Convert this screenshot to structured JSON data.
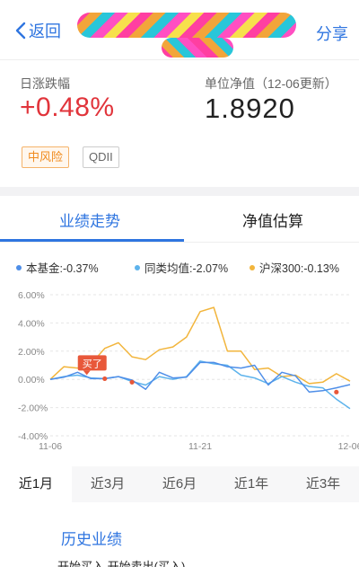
{
  "nav": {
    "back_label": "返回",
    "share_label": "分享"
  },
  "summary": {
    "change_label": "日涨跌幅",
    "change_value": "+0.48%",
    "nav_label": "单位净值（12-06更新）",
    "nav_value": "1.8920",
    "tags": [
      "中风险",
      "QDII"
    ]
  },
  "colors": {
    "accent": "#2f75e0",
    "up": "#e1343b",
    "series_fund": "#4e8ee8",
    "series_peer": "#5db3ec",
    "series_index": "#f2b53c"
  },
  "tabs": [
    "业绩走势",
    "净值估算"
  ],
  "legend": [
    {
      "label": "本基金:-0.37%",
      "color": "#4e8ee8"
    },
    {
      "label": "同类均值:-2.07%",
      "color": "#5db3ec"
    },
    {
      "label": "沪深300:-0.13%",
      "color": "#f2b53c"
    }
  ],
  "periods": [
    "近1月",
    "近3月",
    "近6月",
    "近1年",
    "近3年"
  ],
  "history": {
    "title": "历史业绩",
    "table_header": "开始买入 开始卖出(买入)"
  },
  "chart_data": {
    "type": "line",
    "y_tick_labels": [
      "6.00%",
      "4.00%",
      "2.00%",
      "0.00%",
      "-2.00%",
      "-4.00%"
    ],
    "x_tick_labels": [
      "11-06",
      "11-21",
      "12-06"
    ],
    "ylim": [
      -4,
      6
    ],
    "y_unit": "%",
    "grid": true,
    "x_count": 23,
    "series": [
      {
        "name": "本基金",
        "color": "#4e8ee8",
        "values": [
          0,
          0.15,
          0.5,
          0.05,
          0.05,
          0.2,
          -0.05,
          -0.7,
          0.5,
          0.1,
          0.15,
          1.2,
          1.2,
          0.9,
          0.8,
          1.0,
          -0.4,
          0.5,
          0.25,
          -0.9,
          -0.8,
          -0.6,
          -0.37
        ]
      },
      {
        "name": "同类均值",
        "color": "#5db3ec",
        "values": [
          0,
          0.2,
          0.3,
          0.1,
          0.05,
          0.2,
          -0.15,
          -0.4,
          0.2,
          0,
          0.2,
          1.3,
          1.1,
          1.0,
          0.3,
          0.1,
          -0.3,
          0.2,
          -0.2,
          -0.5,
          -0.6,
          -1.4,
          -2.07
        ]
      },
      {
        "name": "沪深300",
        "color": "#f2b53c",
        "values": [
          0,
          0.9,
          0.8,
          1.1,
          2.2,
          2.6,
          1.6,
          1.4,
          2.1,
          2.3,
          3.0,
          4.8,
          5.1,
          2.0,
          2.0,
          0.7,
          0.8,
          0.2,
          0.3,
          -0.3,
          -0.2,
          0.4,
          -0.13
        ]
      }
    ],
    "markers": [
      {
        "label": "买了",
        "x": 4,
        "y": 0.05,
        "color": "#e8583a"
      },
      {
        "label": "",
        "x": 6,
        "y": -0.2,
        "color": "#e8583a"
      },
      {
        "label": "",
        "x": 21,
        "y": -0.9,
        "color": "#e8583a"
      }
    ]
  }
}
